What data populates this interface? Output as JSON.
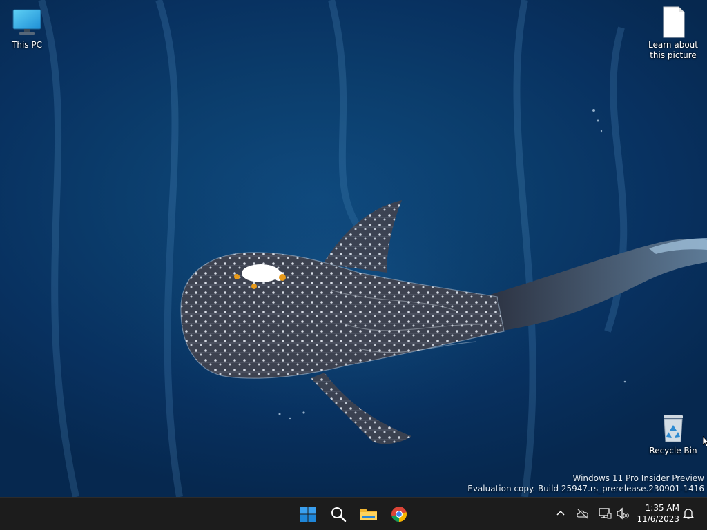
{
  "desktop": {
    "icons": {
      "this_pc": {
        "label": "This PC",
        "icon": "monitor-icon"
      },
      "learn": {
        "label": "Learn about this picture",
        "icon": "document-icon"
      },
      "recycle": {
        "label": "Recycle Bin",
        "icon": "recycle-bin-icon"
      }
    },
    "watermark": {
      "line1": "Windows 11 Pro Insider Preview",
      "line2": "Evaluation copy. Build 25947.rs_prerelease.230901-1416"
    }
  },
  "taskbar": {
    "pinned": [
      {
        "name": "start",
        "icon": "windows-logo-icon"
      },
      {
        "name": "search",
        "icon": "search-icon"
      },
      {
        "name": "file-explorer",
        "icon": "folder-icon"
      },
      {
        "name": "chrome",
        "icon": "chrome-icon"
      }
    ],
    "tray": {
      "icons": [
        "chevron-up-icon",
        "onedrive-offline-icon",
        "network-icon",
        "volume-muted-icon",
        "notification-bell-icon"
      ]
    },
    "clock": {
      "time": "1:35 AM",
      "date": "11/6/2023"
    }
  },
  "colors": {
    "taskbar": "#1c1c1c",
    "wallpaper_deep": "#06284f",
    "wallpaper_mid": "#0b3d6c",
    "windows_blue": "#0078d4"
  }
}
